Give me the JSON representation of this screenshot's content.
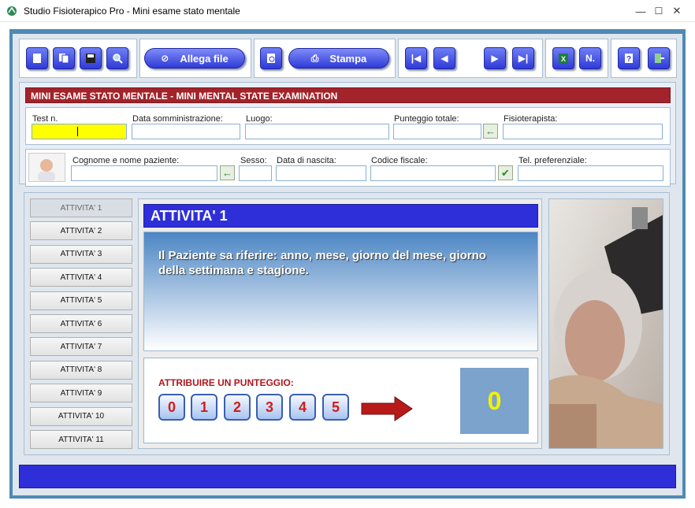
{
  "window": {
    "title": "Studio Fisioterapico Pro - Mini esame stato mentale",
    "minimize": "—",
    "maximize": "☐",
    "close": "✕"
  },
  "toolbar": {
    "allega_label": "Allega file",
    "stampa_label": "Stampa",
    "n_label": "N."
  },
  "form": {
    "section_title": "MINI ESAME STATO MENTALE - MINI MENTAL STATE EXAMINATION",
    "test_n_label": "Test n.",
    "data_label": "Data somministrazione:",
    "luogo_label": "Luogo:",
    "punteggio_label": "Punteggio totale:",
    "fisio_label": "Fisioterapista:",
    "nome_label": "Cognome e nome paziente:",
    "sesso_label": "Sesso:",
    "nascita_label": "Data di nascita:",
    "cf_label": "Codice fiscale:",
    "tel_label": "Tel. preferenziale:"
  },
  "activities": [
    "ATTIVITA' 1",
    "ATTIVITA' 2",
    "ATTIVITA' 3",
    "ATTIVITA' 4",
    "ATTIVITA' 5",
    "ATTIVITA' 6",
    "ATTIVITA' 7",
    "ATTIVITA' 8",
    "ATTIVITA' 9",
    "ATTIVITA' 10",
    "ATTIVITA' 11"
  ],
  "panel": {
    "title": "ATTIVITA' 1",
    "question": "Il Paziente sa riferire: anno, mese, giorno del mese, giorno della settimana e stagione.",
    "score_prompt": "ATTRIBUIRE UN PUNTEGGIO:",
    "scores": [
      "0",
      "1",
      "2",
      "3",
      "4",
      "5"
    ],
    "score_value": "0"
  },
  "colors": {
    "accent": "#2e2fd8",
    "red_bar": "#a3232a",
    "score_box": "#7ba3cb",
    "score_text": "#f2f200"
  }
}
